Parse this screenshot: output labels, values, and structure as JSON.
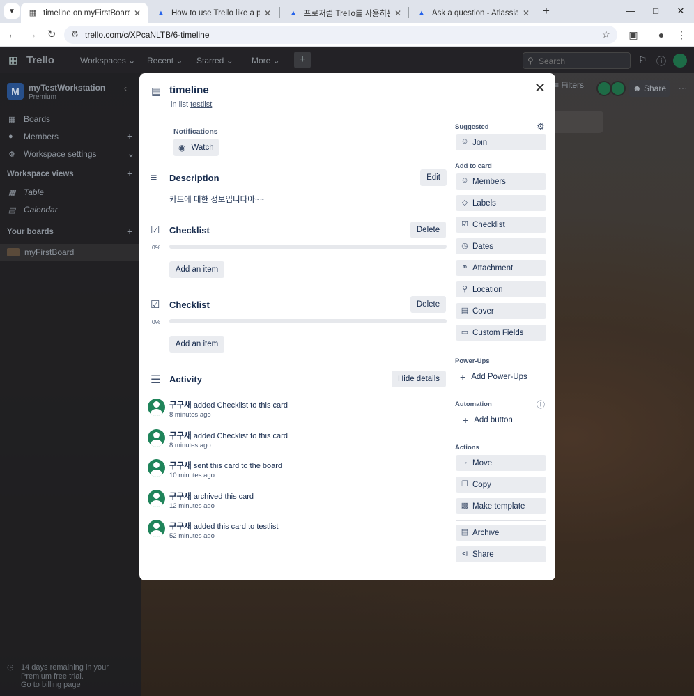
{
  "browser": {
    "tabs": [
      {
        "title": "timeline on myFirstBoard | Tre",
        "active": true
      },
      {
        "title": "How to use Trello like a pro | T",
        "active": false
      },
      {
        "title": "프로저럼 Trello를 사용하는 방",
        "active": false
      },
      {
        "title": "Ask a question - Atlassian Con",
        "active": false
      }
    ],
    "url": "trello.com/c/XPcaNLTB/6-timeline",
    "accent": "#dfe3eb"
  },
  "trello_nav": {
    "logo": "Trello",
    "items": [
      "Workspaces",
      "Recent",
      "Starred",
      "More"
    ],
    "search_placeholder": "Search"
  },
  "sidebar": {
    "workspace_initial": "M",
    "workspace_name": "myTestWorkstation",
    "plan": "Premium",
    "items": [
      {
        "label": "Boards",
        "icon": "board-icon"
      },
      {
        "label": "Members",
        "icon": "person-icon"
      },
      {
        "label": "Workspace settings",
        "icon": "gear-icon"
      }
    ],
    "views_header": "Workspace views",
    "views": [
      {
        "label": "Table",
        "icon": "table-icon"
      },
      {
        "label": "Calendar",
        "icon": "calendar-icon"
      }
    ],
    "boards_header": "Your boards",
    "board": "myFirstBoard",
    "trial_line1": "14 days remaining in your",
    "trial_line2": "Premium free trial.",
    "trial_line3": "Go to billing page"
  },
  "board_bar": {
    "filters": "Filters",
    "share": "Share"
  },
  "card": {
    "title": "timeline",
    "in_list_prefix": "in list",
    "list_name": "testlist",
    "notifications_label": "Notifications",
    "watch_label": "Watch",
    "description_heading": "Description",
    "edit_label": "Edit",
    "description_text": "카드에 대한 정보입니다아~~",
    "checklists": [
      {
        "title": "Checklist",
        "delete_label": "Delete",
        "percent": "0%",
        "progress": 0,
        "add_label": "Add an item"
      },
      {
        "title": "Checklist",
        "delete_label": "Delete",
        "percent": "0%",
        "progress": 0,
        "add_label": "Add an item"
      }
    ],
    "activity_heading": "Activity",
    "hide_details_label": "Hide details",
    "activity": [
      {
        "user": "구구새",
        "action": "added Checklist to this card",
        "time": "8 minutes ago"
      },
      {
        "user": "구구새",
        "action": "added Checklist to this card",
        "time": "8 minutes ago"
      },
      {
        "user": "구구새",
        "action": "sent this card to the board",
        "time": "10 minutes ago"
      },
      {
        "user": "구구새",
        "action": "archived this card",
        "time": "12 minutes ago"
      },
      {
        "user": "구구새",
        "action": "added this card to testlist",
        "time": "52 minutes ago"
      }
    ],
    "side": {
      "suggested_header": "Suggested",
      "join_label": "Join",
      "add_to_card_header": "Add to card",
      "add_to_card": [
        {
          "label": "Members",
          "icon": "person-icon"
        },
        {
          "label": "Labels",
          "icon": "tag-icon"
        },
        {
          "label": "Checklist",
          "icon": "checklist-icon"
        },
        {
          "label": "Dates",
          "icon": "clock-icon"
        },
        {
          "label": "Attachment",
          "icon": "paperclip-icon"
        },
        {
          "label": "Location",
          "icon": "location-pin-icon"
        },
        {
          "label": "Cover",
          "icon": "cover-icon"
        },
        {
          "label": "Custom Fields",
          "icon": "custom-fields-icon"
        }
      ],
      "powerups_header": "Power-Ups",
      "add_powerups_label": "Add Power-Ups",
      "automation_header": "Automation",
      "add_button_label": "Add button",
      "actions_header": "Actions",
      "actions": [
        {
          "label": "Move",
          "icon": "arrow-right-icon"
        },
        {
          "label": "Copy",
          "icon": "copy-icon"
        },
        {
          "label": "Make template",
          "icon": "template-icon"
        }
      ],
      "actions2": [
        {
          "label": "Archive",
          "icon": "archive-icon"
        },
        {
          "label": "Share",
          "icon": "share-icon"
        }
      ]
    },
    "avatar_color": "#1f845a"
  }
}
